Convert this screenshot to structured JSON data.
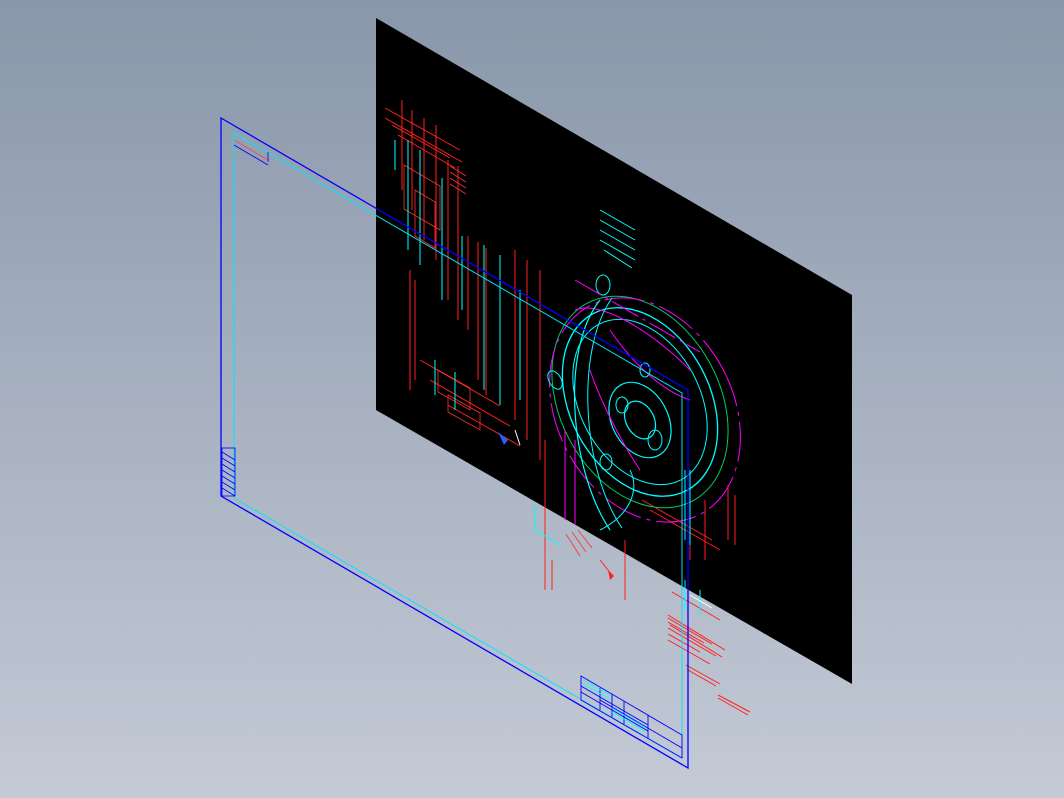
{
  "viewport": {
    "background_top": "#8997aa",
    "background_bottom": "#c4cad6"
  },
  "drawing_sheet": {
    "fill": "#000000",
    "colors": {
      "dimension": "#ff0000",
      "geometry": "#00ffff",
      "centerline": "#ff00ff",
      "outline": "#00cc66",
      "accent": "#ffffff"
    }
  },
  "paper_frame": {
    "outer_color": "#0000ff",
    "inner_color": "#00e5ff",
    "title_block_color": "#0000ff"
  },
  "icons": [
    "isometric-sheet-icon",
    "cad-frame-icon"
  ]
}
